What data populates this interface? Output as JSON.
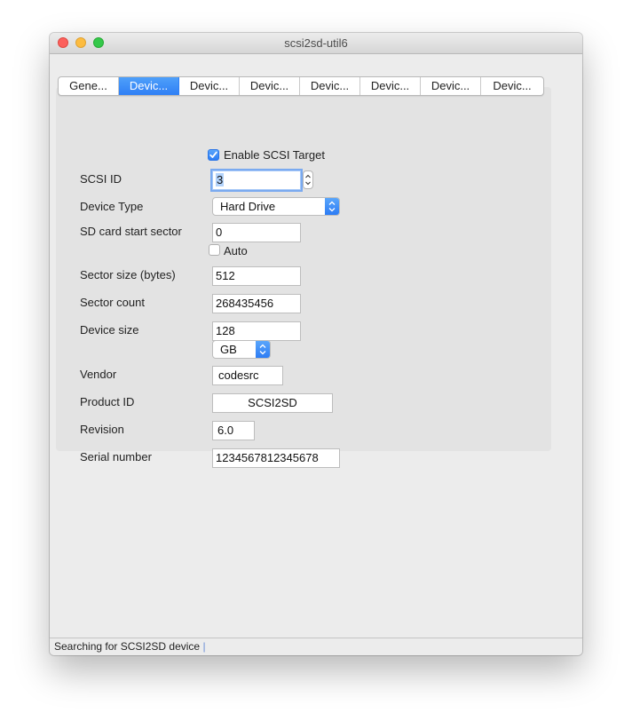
{
  "window": {
    "title": "scsi2sd-util6"
  },
  "tabs": [
    {
      "label": "Gene...",
      "active": false
    },
    {
      "label": "Devic...",
      "active": true
    },
    {
      "label": "Devic...",
      "active": false
    },
    {
      "label": "Devic...",
      "active": false
    },
    {
      "label": "Devic...",
      "active": false
    },
    {
      "label": "Devic...",
      "active": false
    },
    {
      "label": "Devic...",
      "active": false
    },
    {
      "label": "Devic...",
      "active": false
    }
  ],
  "form": {
    "enable_scsi_target": {
      "label": "Enable SCSI Target",
      "checked": true
    },
    "scsi_id": {
      "label": "SCSI ID",
      "value": "3"
    },
    "device_type": {
      "label": "Device Type",
      "value": "Hard Drive"
    },
    "sd_card_start_sector": {
      "label": "SD card start sector",
      "value": "0"
    },
    "auto": {
      "label": "Auto",
      "checked": false
    },
    "sector_size": {
      "label": "Sector size (bytes)",
      "value": "512"
    },
    "sector_count": {
      "label": "Sector count",
      "value": "268435456"
    },
    "device_size": {
      "label": "Device size",
      "value": "128",
      "unit": "GB"
    },
    "vendor": {
      "label": "Vendor",
      "value": "codesrc"
    },
    "product_id": {
      "label": "Product ID",
      "value": "SCSI2SD"
    },
    "revision": {
      "label": "Revision",
      "value": "6.0"
    },
    "serial_number": {
      "label": "Serial number",
      "value": "1234567812345678"
    }
  },
  "status": {
    "text": "Searching for SCSI2SD device",
    "spinner": "|"
  },
  "colors": {
    "accent": "#2f7ff5",
    "close": "#fc605c",
    "minimize": "#fdbc40",
    "maximize": "#34c84a"
  }
}
